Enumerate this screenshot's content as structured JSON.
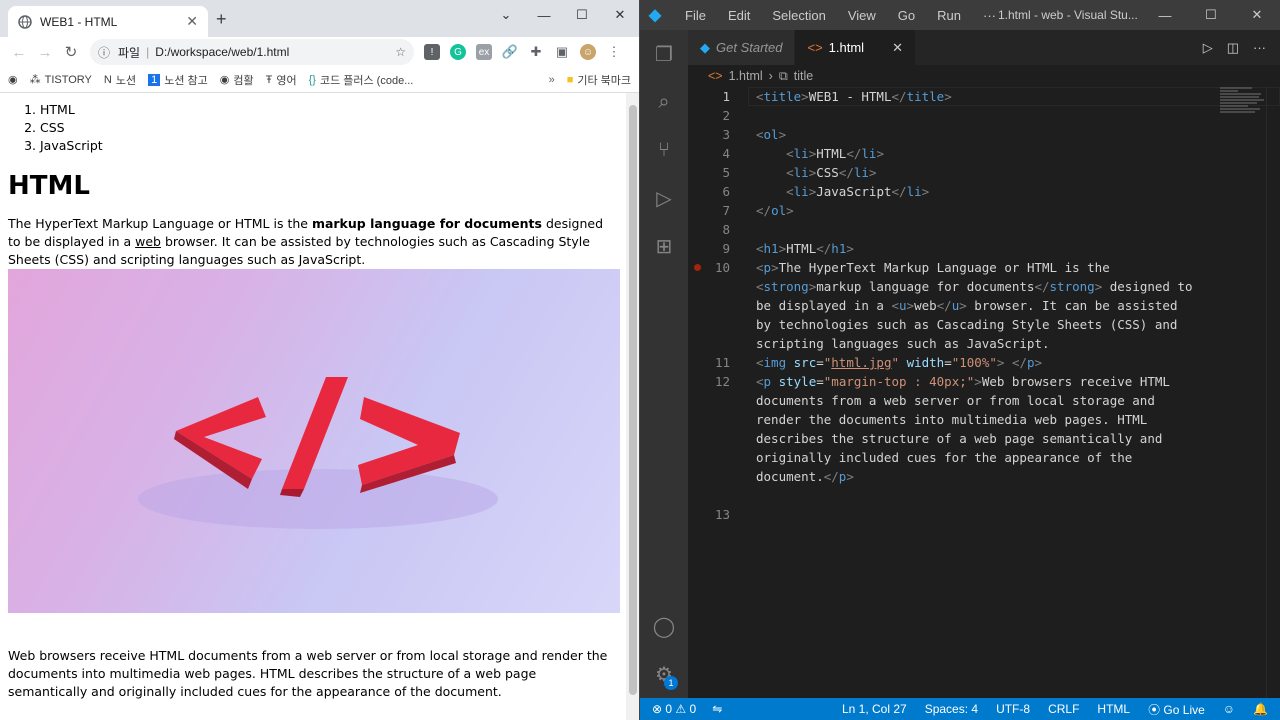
{
  "browser": {
    "tab_title": "WEB1 - HTML",
    "address_scheme": "파일",
    "address_url": "D:/workspace/web/1.html",
    "bookmarks": [
      "TISTORY",
      "노션",
      "노션 참고",
      "컴활",
      "영어",
      "코드 플러스 (code..."
    ],
    "bookmarks_more": "»",
    "other_bookmarks": "기타 북마크",
    "page": {
      "list": [
        "HTML",
        "CSS",
        "JavaScript"
      ],
      "heading": "HTML",
      "p1_a": "The HyperText Markup Language or HTML is the ",
      "p1_strong": "markup language for documents",
      "p1_b": " designed to be displayed in a ",
      "p1_u": "web",
      "p1_c": " browser. It can be assisted by technologies such as Cascading Style Sheets (CSS) and scripting languages such as JavaScript.",
      "p2": "Web browsers receive HTML documents from a web server or from local storage and render the documents into multimedia web pages. HTML describes the structure of a web page semantically and originally included cues for the appearance of the document."
    }
  },
  "vscode": {
    "menu": [
      "File",
      "Edit",
      "Selection",
      "View",
      "Go",
      "Run",
      "···"
    ],
    "window_title": "1.html - web - Visual Stu...",
    "tabs": {
      "welcome": "Get Started",
      "active": "1.html"
    },
    "breadcrumb": {
      "file": "1.html",
      "symbol": "title"
    },
    "status": {
      "errors": "0",
      "warnings": "0",
      "position": "Ln 1, Col 27",
      "spaces": "Spaces: 4",
      "encoding": "UTF-8",
      "eol": "CRLF",
      "language": "HTML",
      "golive": "Go Live"
    },
    "badge": "1",
    "code_lines": [
      {
        "n": "1",
        "cls": "cur"
      },
      {
        "n": "2"
      },
      {
        "n": "3"
      },
      {
        "n": "4"
      },
      {
        "n": "5"
      },
      {
        "n": "6"
      },
      {
        "n": "7"
      },
      {
        "n": "8"
      },
      {
        "n": "9"
      },
      {
        "n": "10",
        "bp": true
      },
      {
        "n": ""
      },
      {
        "n": ""
      },
      {
        "n": ""
      },
      {
        "n": ""
      },
      {
        "n": "11"
      },
      {
        "n": "12"
      },
      {
        "n": ""
      },
      {
        "n": ""
      },
      {
        "n": ""
      },
      {
        "n": ""
      },
      {
        "n": ""
      },
      {
        "n": ""
      },
      {
        "n": "13"
      }
    ]
  }
}
